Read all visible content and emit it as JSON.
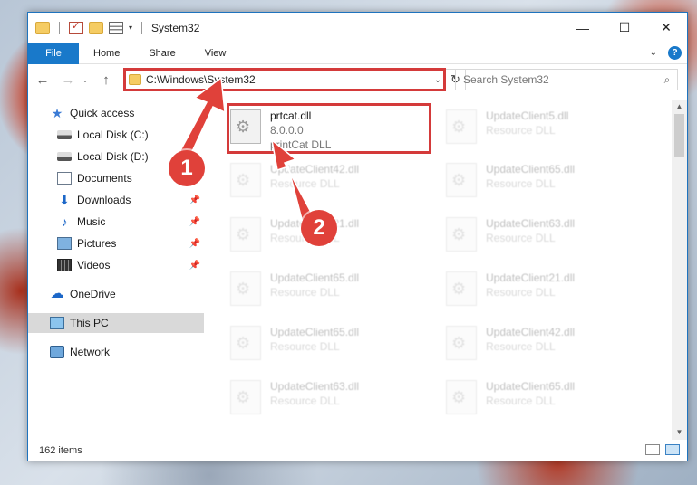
{
  "window": {
    "title": "System32",
    "minimize": "—",
    "maximize": "☐",
    "close": "✕"
  },
  "ribbon": {
    "file": "File",
    "tabs": [
      "Home",
      "Share",
      "View"
    ],
    "expand": "⌄",
    "help": "?"
  },
  "nav": {
    "back": "←",
    "forward": "→",
    "recent": "⌄",
    "up": "↑",
    "address": "C:\\Windows\\System32",
    "address_drop": "⌄",
    "refresh": "↻",
    "search_placeholder": "Search System32",
    "search_icon": "⌕"
  },
  "sidebar": {
    "items": [
      {
        "label": "Quick access",
        "icon": "star-icon"
      },
      {
        "label": "Local Disk (C:)",
        "icon": "drive-icon",
        "pinned": false
      },
      {
        "label": "Local Disk (D:)",
        "icon": "drive-icon",
        "pinned": false
      },
      {
        "label": "Documents",
        "icon": "documents-icon",
        "pinned": false
      },
      {
        "label": "Downloads",
        "icon": "downloads-icon",
        "pinned": true
      },
      {
        "label": "Music",
        "icon": "music-icon",
        "pinned": true
      },
      {
        "label": "Pictures",
        "icon": "pictures-icon",
        "pinned": true
      },
      {
        "label": "Videos",
        "icon": "videos-icon",
        "pinned": true
      },
      {
        "label": "OneDrive",
        "icon": "cloud-icon"
      },
      {
        "label": "This PC",
        "icon": "pc-icon",
        "selected": true
      },
      {
        "label": "Network",
        "icon": "network-icon"
      }
    ],
    "pin_glyph": "📌"
  },
  "files": [
    {
      "name": "prtcat.dll",
      "line2": "8.0.0.0",
      "line3": "printCat DLL",
      "highlight": true
    },
    {
      "name": "UpdateClient5.dll",
      "line2": "Resource DLL"
    },
    {
      "name": "UpdateClient42.dll",
      "line2": "Resource DLL"
    },
    {
      "name": "UpdateClient65.dll",
      "line2": "Resource DLL"
    },
    {
      "name": "UpdateClient21.dll",
      "line2": "Resource DLL"
    },
    {
      "name": "UpdateClient63.dll",
      "line2": "Resource DLL"
    },
    {
      "name": "UpdateClient65.dll",
      "line2": "Resource DLL"
    },
    {
      "name": "UpdateClient21.dll",
      "line2": "Resource DLL"
    },
    {
      "name": "UpdateClient65.dll",
      "line2": "Resource DLL"
    },
    {
      "name": "UpdateClient42.dll",
      "line2": "Resource DLL"
    },
    {
      "name": "UpdateClient63.dll",
      "line2": "Resource DLL"
    },
    {
      "name": "UpdateClient65.dll",
      "line2": "Resource DLL"
    }
  ],
  "status": {
    "items_count": "162 items"
  },
  "annotations": {
    "step1": "1",
    "step2": "2",
    "color": "#e0413a"
  }
}
